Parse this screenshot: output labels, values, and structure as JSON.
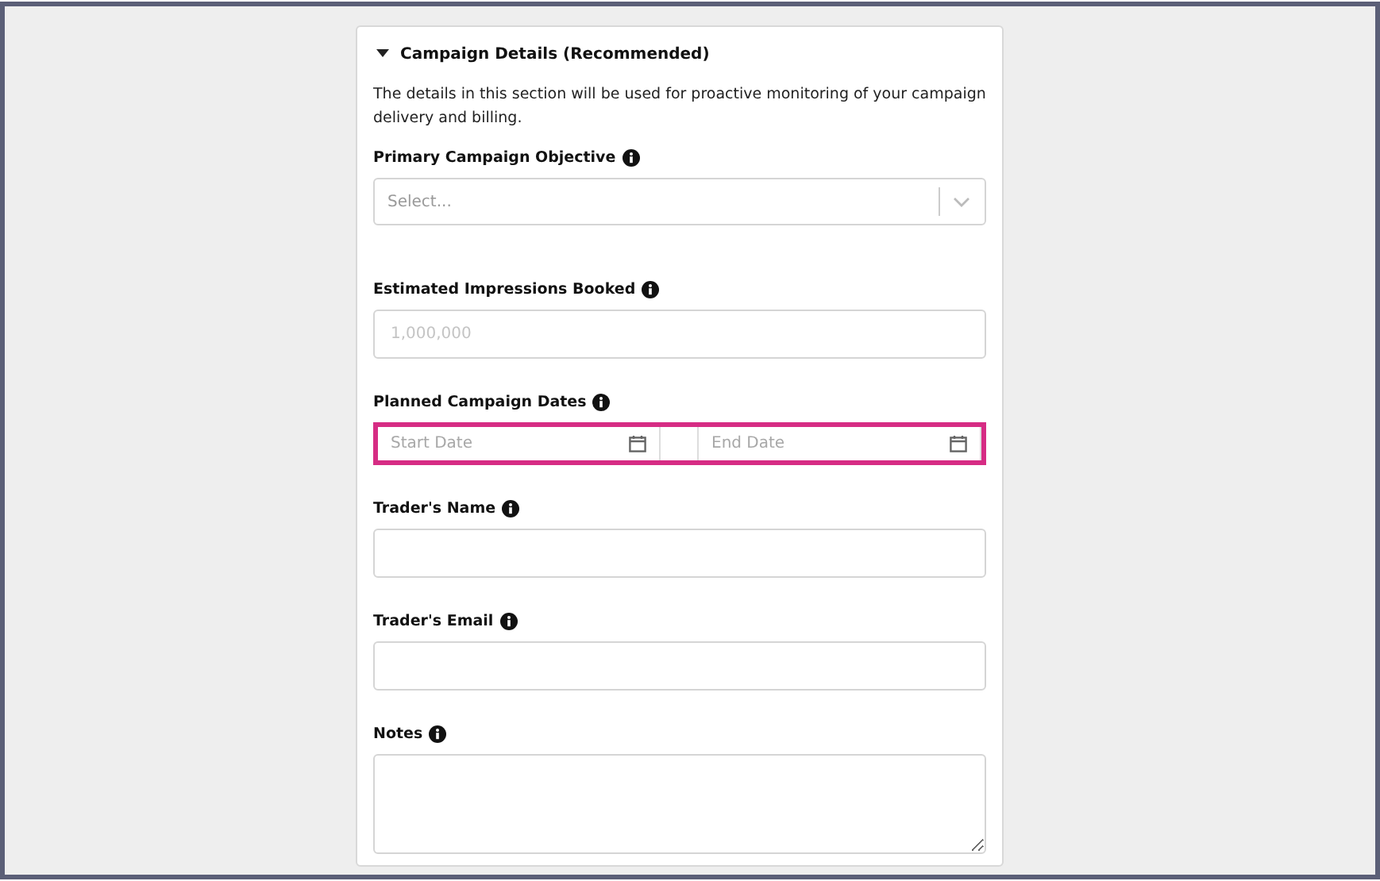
{
  "section": {
    "title": "Campaign Details (Recommended)",
    "expanded": true,
    "description": "The details in this section will be used for proactive monitoring of your campaign delivery and billing."
  },
  "fields": [
    {
      "kind": "select",
      "label": "Primary Campaign Objective",
      "placeholder": "Select..."
    },
    {
      "kind": "text",
      "label": "Estimated Impressions Booked",
      "placeholder": "1,000,000"
    },
    {
      "kind": "daterange",
      "label": "Planned Campaign Dates",
      "start_placeholder": "Start Date",
      "end_placeholder": "End Date",
      "highlighted": true
    },
    {
      "kind": "text",
      "label": "Trader's Name"
    },
    {
      "kind": "text",
      "label": "Trader's Email"
    },
    {
      "kind": "textarea",
      "label": "Notes"
    }
  ]
}
